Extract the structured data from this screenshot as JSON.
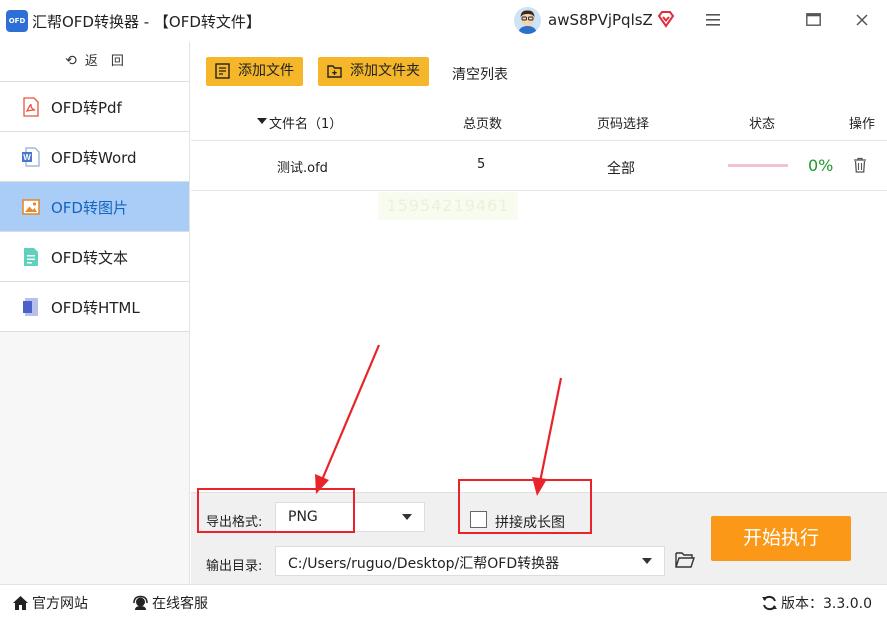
{
  "titlebar": {
    "logo_text": "OFD",
    "title": "汇帮OFD转换器 - 【OFD转文件】",
    "username": "awS8PVjPqlsZ",
    "menu_icon": "hamburger-icon",
    "maximize_icon": "maximize-icon",
    "close_icon": "close-icon"
  },
  "sidebar": {
    "back_label": "返　回",
    "items": [
      {
        "label": "OFD转Pdf",
        "icon": "pdf-icon",
        "color": "#e8543d"
      },
      {
        "label": "OFD转Word",
        "icon": "word-icon",
        "color": "#4a78c8"
      },
      {
        "label": "OFD转图片",
        "icon": "image-icon",
        "color": "#e58a2c"
      },
      {
        "label": "OFD转文本",
        "icon": "text-icon",
        "color": "#2fb7a0"
      },
      {
        "label": "OFD转HTML",
        "icon": "html-icon",
        "color": "#4a62c8"
      }
    ],
    "active_index": 2
  },
  "toolbar": {
    "add_file": "添加文件",
    "add_folder": "添加文件夹",
    "clear_list": "清空列表"
  },
  "table": {
    "headers": {
      "filename": "文件名（1）",
      "pages": "总页数",
      "page_select": "页码选择",
      "status": "状态",
      "action": "操作"
    },
    "rows": [
      {
        "filename": "测试.ofd",
        "pages": "5",
        "page_select": "全部",
        "progress": "0%"
      }
    ],
    "watermark": "15954219461"
  },
  "options": {
    "format_label": "导出格式:",
    "format_value": "PNG",
    "merge_label": "拼接成长图",
    "merge_checked": false,
    "output_label": "输出目录:",
    "output_path": "C:/Users/ruguo/Desktop/汇帮OFD转换器",
    "start_button": "开始执行"
  },
  "footer": {
    "website": "官方网站",
    "support": "在线客服",
    "version_label": "版本：",
    "version": "3.3.0.0"
  },
  "colors": {
    "accent_yellow": "#f5b62a",
    "start_orange": "#fb9817",
    "active_nav": "#a9cdf6",
    "annotation_red": "#e8242a",
    "progress_green": "#1e9a2b"
  }
}
